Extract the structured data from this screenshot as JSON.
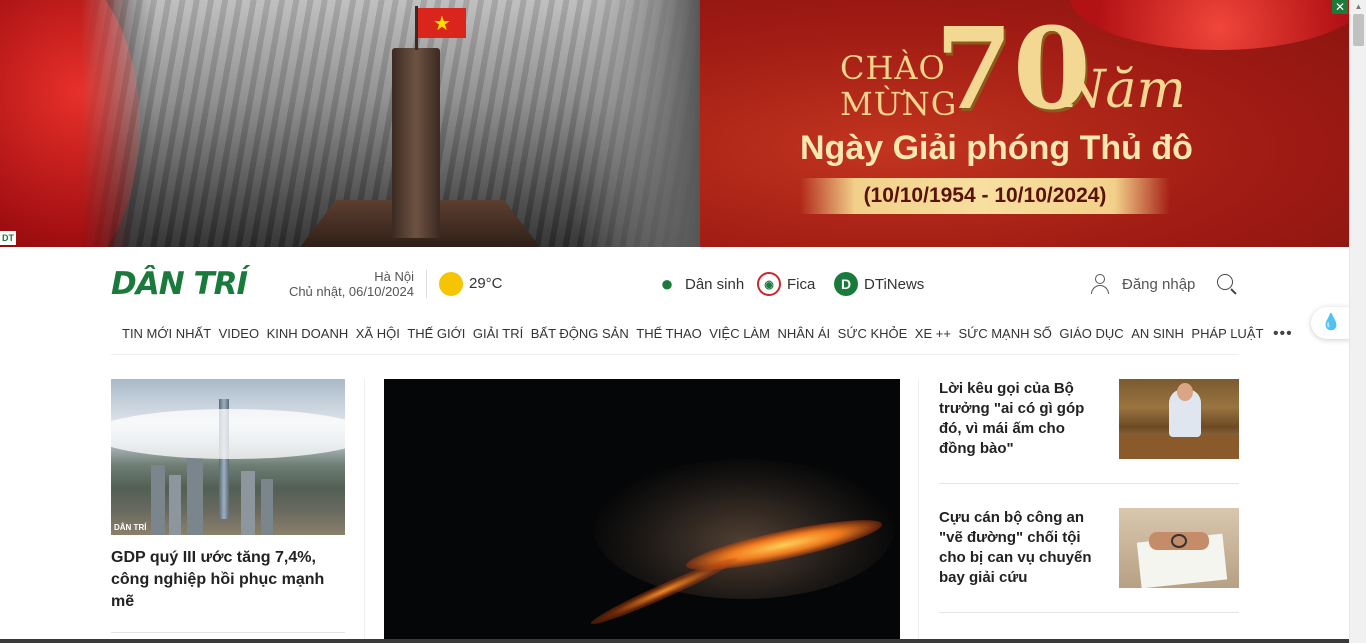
{
  "banner": {
    "chao_line1": "CHÀO",
    "chao_line2": "MỪNG",
    "number": "70",
    "nam": "Năm",
    "subtitle": "Ngày Giải phóng Thủ đô",
    "dates": "(10/10/1954 - 10/10/2024)",
    "flag_star": "★",
    "mini_logo": "DT",
    "close_symbol": "✕"
  },
  "header": {
    "logo": "DÂN TRÍ",
    "city": "Hà Nội",
    "date": "Chủ nhật, 06/10/2024",
    "temperature": "29°C",
    "brands": [
      {
        "label": "Dân sinh",
        "icon": "drop-icon"
      },
      {
        "label": "Fica",
        "icon": "globe-icon"
      },
      {
        "label": "DTiNews",
        "icon": "d-icon"
      }
    ],
    "login": "Đăng nhập"
  },
  "nav": {
    "items": [
      "TIN MỚI NHẤT",
      "VIDEO",
      "KINH DOANH",
      "XÃ HỘI",
      "THẾ GIỚI",
      "GIẢI TRÍ",
      "BẤT ĐỘNG SẢN",
      "THỂ THAO",
      "VIỆC LÀM",
      "NHÂN ÁI",
      "SỨC KHỎE",
      "XE ++",
      "SỨC MẠNH SỐ",
      "GIÁO DỤC",
      "AN SINH",
      "PHÁP LUẬT"
    ],
    "more": "•••"
  },
  "articles": {
    "left": {
      "title": "GDP quý III ước tăng 7,4%, công nghiệp hồi phục mạnh mẽ",
      "watermark": "DÂN TRÍ"
    },
    "side": [
      {
        "title": "Lời kêu gọi của Bộ trưởng \"ai có gì góp đó, vì mái ấm cho đồng bào\""
      },
      {
        "title": "Cựu cán bộ công an \"vẽ đường\" chối tội cho bị can vụ chuyến bay giải cứu"
      }
    ]
  },
  "float_button": "💧"
}
